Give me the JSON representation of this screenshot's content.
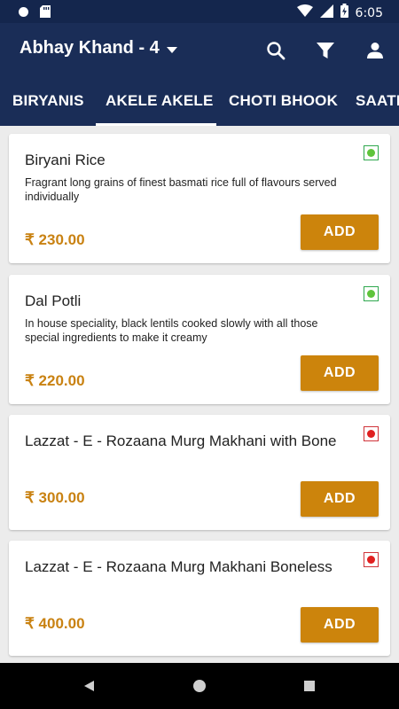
{
  "status_bar": {
    "time": "6:05",
    "icons": [
      "circle-icon",
      "sd-card-icon",
      "wifi-icon",
      "signal-icon",
      "battery-charging-icon"
    ]
  },
  "header": {
    "location": "Abhay Khand - 4",
    "icons": [
      "chevron-down-icon",
      "search-icon",
      "filter-icon",
      "account-icon"
    ]
  },
  "tabs": [
    {
      "label": "BIRYANIS",
      "selected": false
    },
    {
      "label": "AKELE AKELE",
      "selected": true
    },
    {
      "label": "CHOTI BHOOK",
      "selected": false
    },
    {
      "label": "SAATH",
      "selected": false
    }
  ],
  "items": [
    {
      "name": "Biryani Rice",
      "description": "Fragrant long grains of finest basmati rice full of flavours served individually",
      "price": "₹ 230.00",
      "type": "veg",
      "button": "ADD"
    },
    {
      "name": "Dal Potli",
      "description": "In house speciality, black lentils cooked slowly with all those special ingredients to make it creamy",
      "price": "₹ 220.00",
      "type": "veg",
      "button": "ADD"
    },
    {
      "name": "Lazzat - E - Rozaana Murg Makhani with Bone",
      "description": "",
      "price": "₹ 300.00",
      "type": "non-veg",
      "button": "ADD"
    },
    {
      "name": "Lazzat - E - Rozaana Murg Makhani Boneless",
      "description": "",
      "price": "₹ 400.00",
      "type": "non-veg",
      "button": "ADD"
    }
  ],
  "colors": {
    "header_bg": "#1a2d57",
    "accent": "#cc840c",
    "price": "#c98212",
    "veg": "#5ec43b",
    "non_veg": "#e02020"
  },
  "nav_bar": {
    "icons": [
      "back-icon",
      "home-icon",
      "recents-icon"
    ]
  }
}
